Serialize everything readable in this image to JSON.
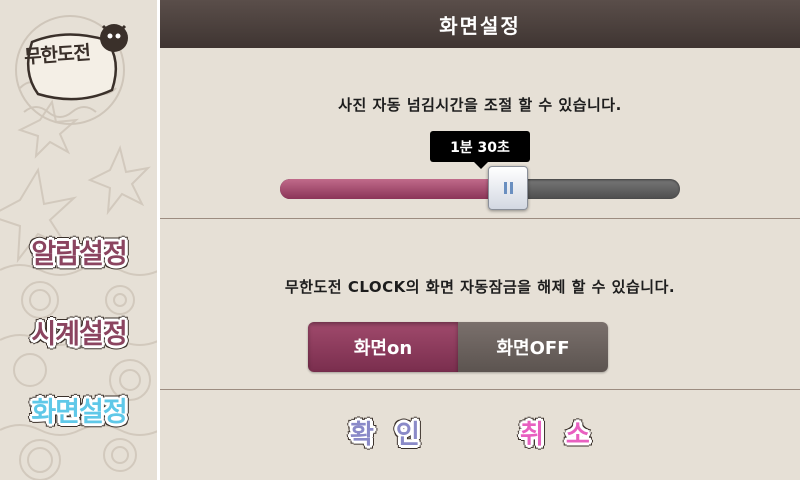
{
  "sidebar": {
    "logo_text": "무한도전",
    "items": [
      {
        "label": "알람설정",
        "active": false
      },
      {
        "label": "시계설정",
        "active": false
      },
      {
        "label": "화면설정",
        "active": true
      }
    ]
  },
  "header": {
    "title": "화면설정"
  },
  "slideshow": {
    "description": "사진 자동 넘김시간을 조절 할 수 있습니다.",
    "value_label": "1분 30초",
    "fraction": 0.57
  },
  "screen_lock": {
    "description": "무한도전 CLOCK의 화면 자동잠금을 해제 할 수 있습니다.",
    "on_label": "화면on",
    "off_label": "화면OFF",
    "selected": "on"
  },
  "actions": {
    "confirm": [
      "확",
      "인"
    ],
    "cancel": [
      "취",
      "소"
    ]
  },
  "colors": {
    "accent": "#8b3558",
    "header_bg": "#4a3f3c",
    "panel_bg": "#e6e0d6"
  }
}
